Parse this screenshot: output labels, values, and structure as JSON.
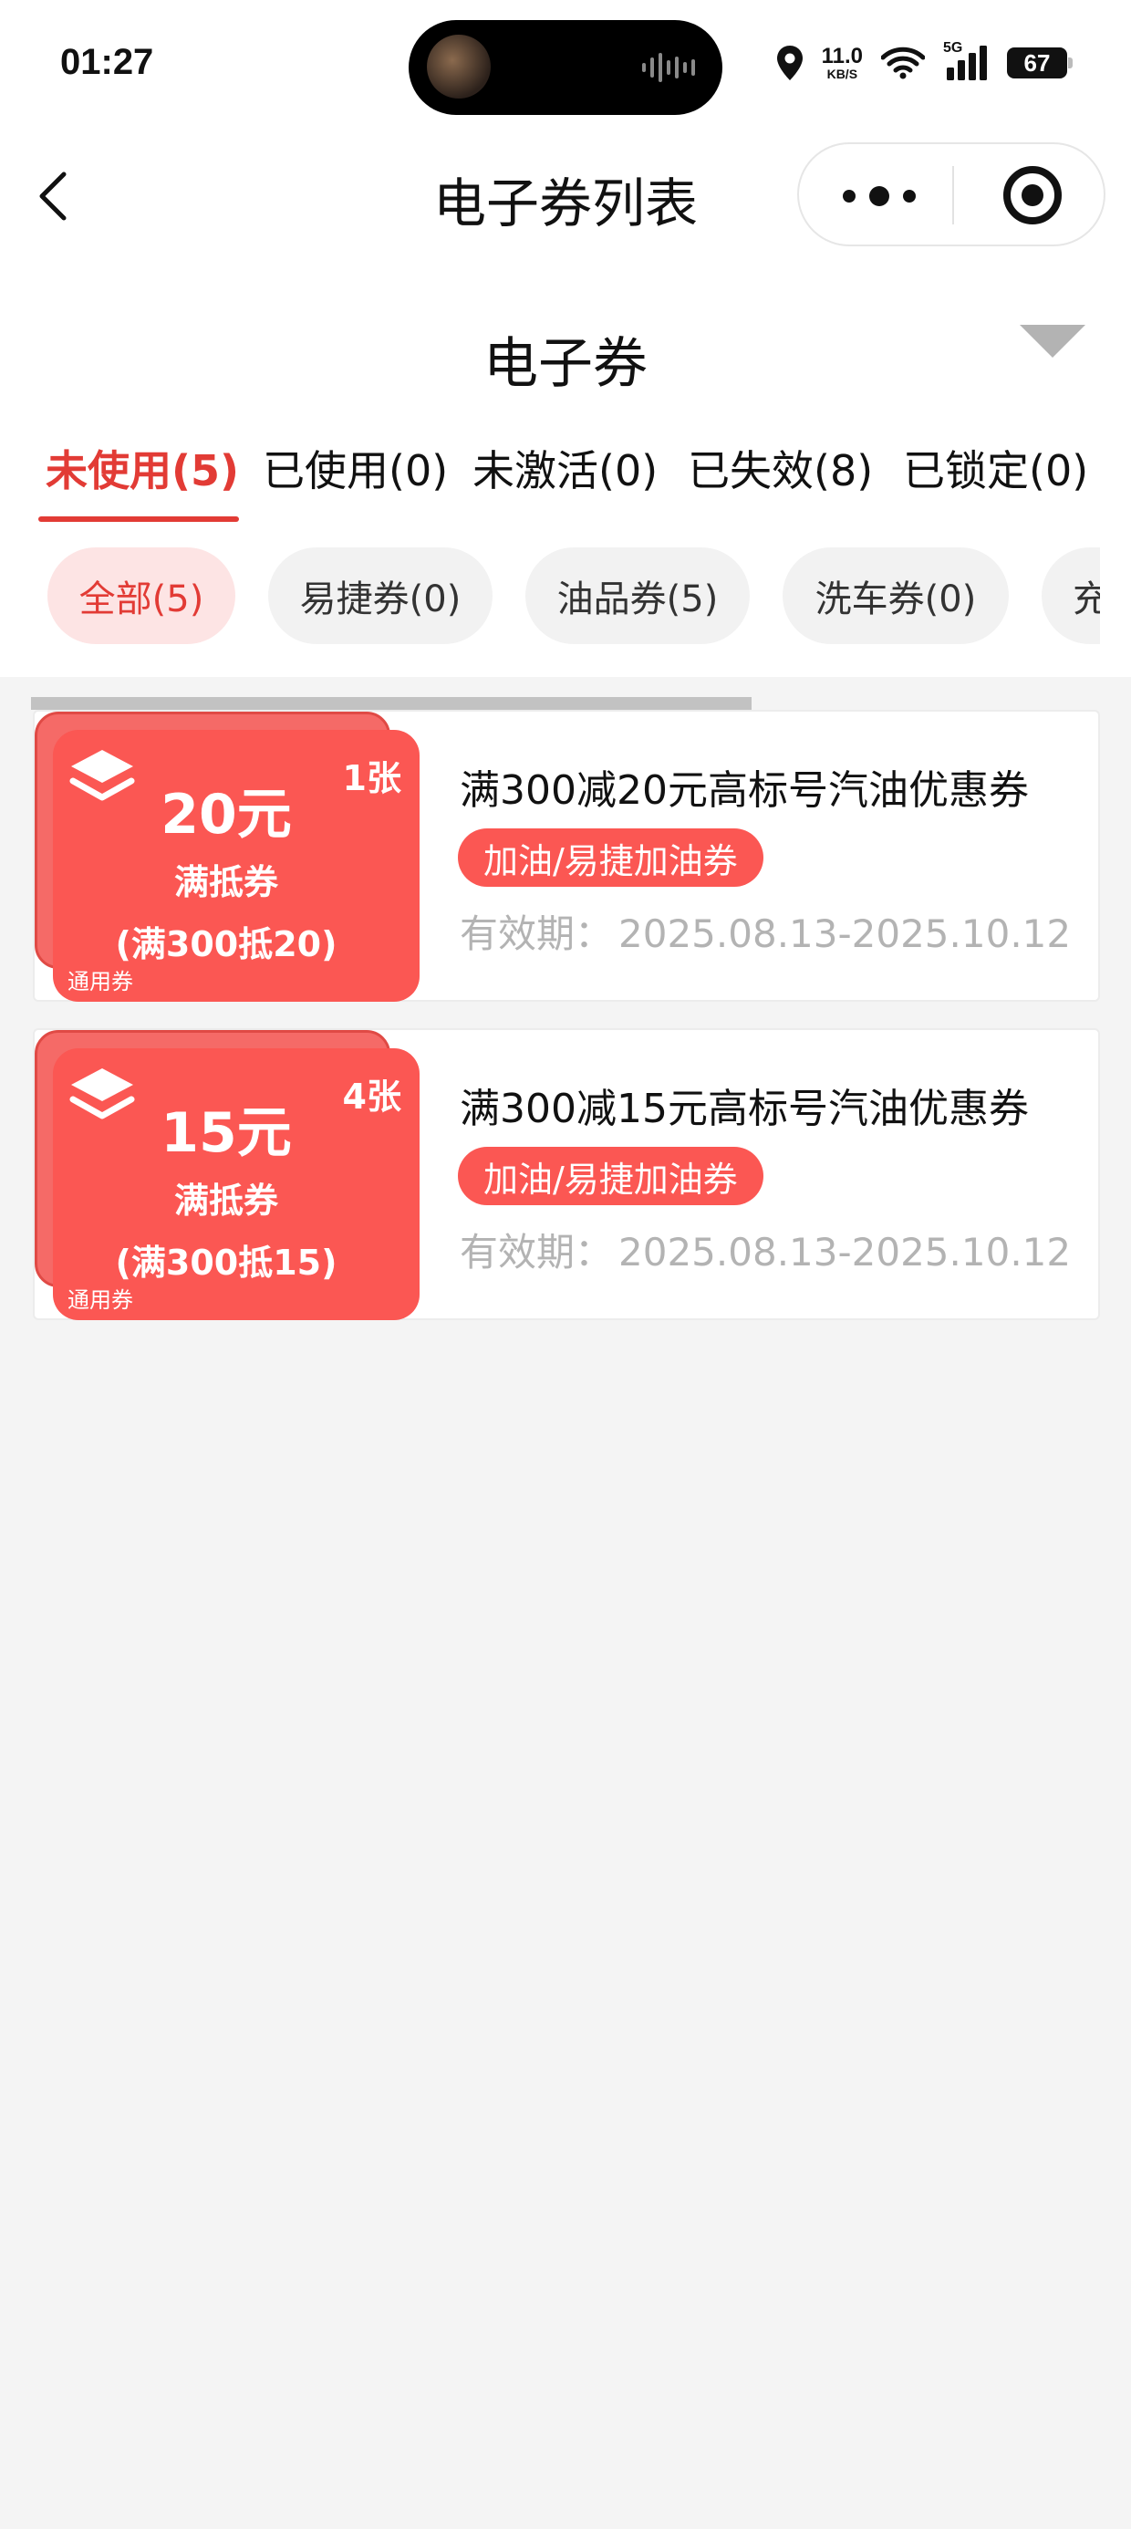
{
  "status_bar": {
    "time": "01:27",
    "net_speed_value": "11.0",
    "net_speed_unit": "KB/S",
    "network_type": "5G",
    "battery": "67"
  },
  "nav": {
    "title": "电子券列表",
    "back_icon": "chevron-left-icon",
    "more_icon": "more-dots-icon",
    "target_icon": "target-icon"
  },
  "section": {
    "title": "电子券",
    "dropdown_icon": "triangle-down-icon"
  },
  "tabs": [
    {
      "label": "未使用(5)",
      "active": true
    },
    {
      "label": "已使用(0)",
      "active": false
    },
    {
      "label": "未激活(0)",
      "active": false
    },
    {
      "label": "已失效(8)",
      "active": false
    },
    {
      "label": "已锁定(0)",
      "active": false
    }
  ],
  "chips": [
    {
      "label": "全部(5)",
      "active": true
    },
    {
      "label": "易捷券(0)",
      "active": false
    },
    {
      "label": "油品券(5)",
      "active": false
    },
    {
      "label": "洗车券(0)",
      "active": false
    },
    {
      "label": "充",
      "active": false
    }
  ],
  "coupons": [
    {
      "count": "1张",
      "amount": "20元",
      "type": "满抵券",
      "condition": "(满300抵20)",
      "general_label": "通用券",
      "title": "满300减20元高标号汽油优惠券",
      "tag": "加油/易捷加油券",
      "validity_label": "有效期：",
      "validity": "2025.08.13-2025.10.12"
    },
    {
      "count": "4张",
      "amount": "15元",
      "type": "满抵券",
      "condition": "(满300抵15)",
      "general_label": "通用券",
      "title": "满300减15元高标号汽油优惠券",
      "tag": "加油/易捷加油券",
      "validity_label": "有效期：",
      "validity": "2025.08.13-2025.10.12"
    }
  ],
  "colors": {
    "accent": "#e23b35",
    "coupon_red": "#fb5753",
    "chip_active_bg": "#fde4e4",
    "page_bg": "#f4f4f4"
  }
}
